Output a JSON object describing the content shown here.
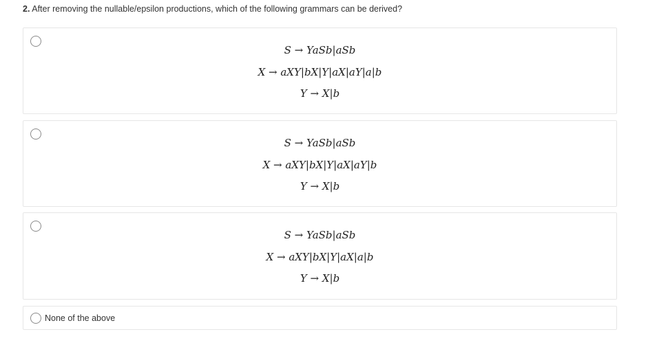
{
  "question": {
    "number": "2.",
    "text": "After removing the nullable/epsilon productions, which of the following grammars can be derived?"
  },
  "options": [
    {
      "lines": [
        "S → YaSb|aSb",
        "X → aXY|bX|Y|aX|aY|a|b",
        "Y → X|b"
      ]
    },
    {
      "lines": [
        "S → YaSb|aSb",
        "X → aXY|bX|Y|aX|aY|b",
        "Y → X|b"
      ]
    },
    {
      "lines": [
        "S → YaSb|aSb",
        "X → aXY|bX|Y|aX|a|b",
        "Y → X|b"
      ]
    },
    {
      "label": "None of the above"
    }
  ]
}
